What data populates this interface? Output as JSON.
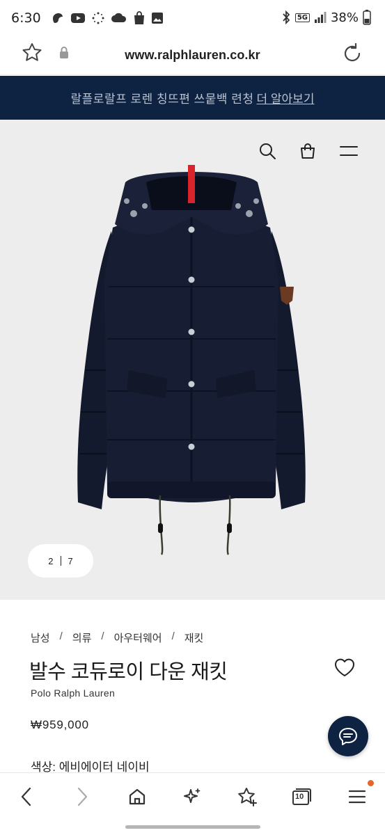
{
  "status_bar": {
    "time": "6:30",
    "network": "5G",
    "battery": "38%"
  },
  "browser": {
    "url": "www.ralphlauren.co.kr"
  },
  "promo": {
    "text": "랄플로랄프 로렌 칭뜨편 쓰뭍백 련청",
    "link_label": "더 알아보기"
  },
  "gallery": {
    "current": "2",
    "total": "7"
  },
  "product": {
    "breadcrumb": [
      "남성",
      "의류",
      "아우터웨어",
      "재킷"
    ],
    "title": "발수 코듀로이 다운 재킷",
    "brand": "Polo Ralph Lauren",
    "price": "₩959,000",
    "color_label": "색상:",
    "color_value": "에비에이터 네이비"
  },
  "nav": {
    "tabs_count": "10"
  },
  "colors": {
    "navy": "#0e2241",
    "accent_dot": "#e3672a",
    "hero_bg": "#eeeded"
  }
}
